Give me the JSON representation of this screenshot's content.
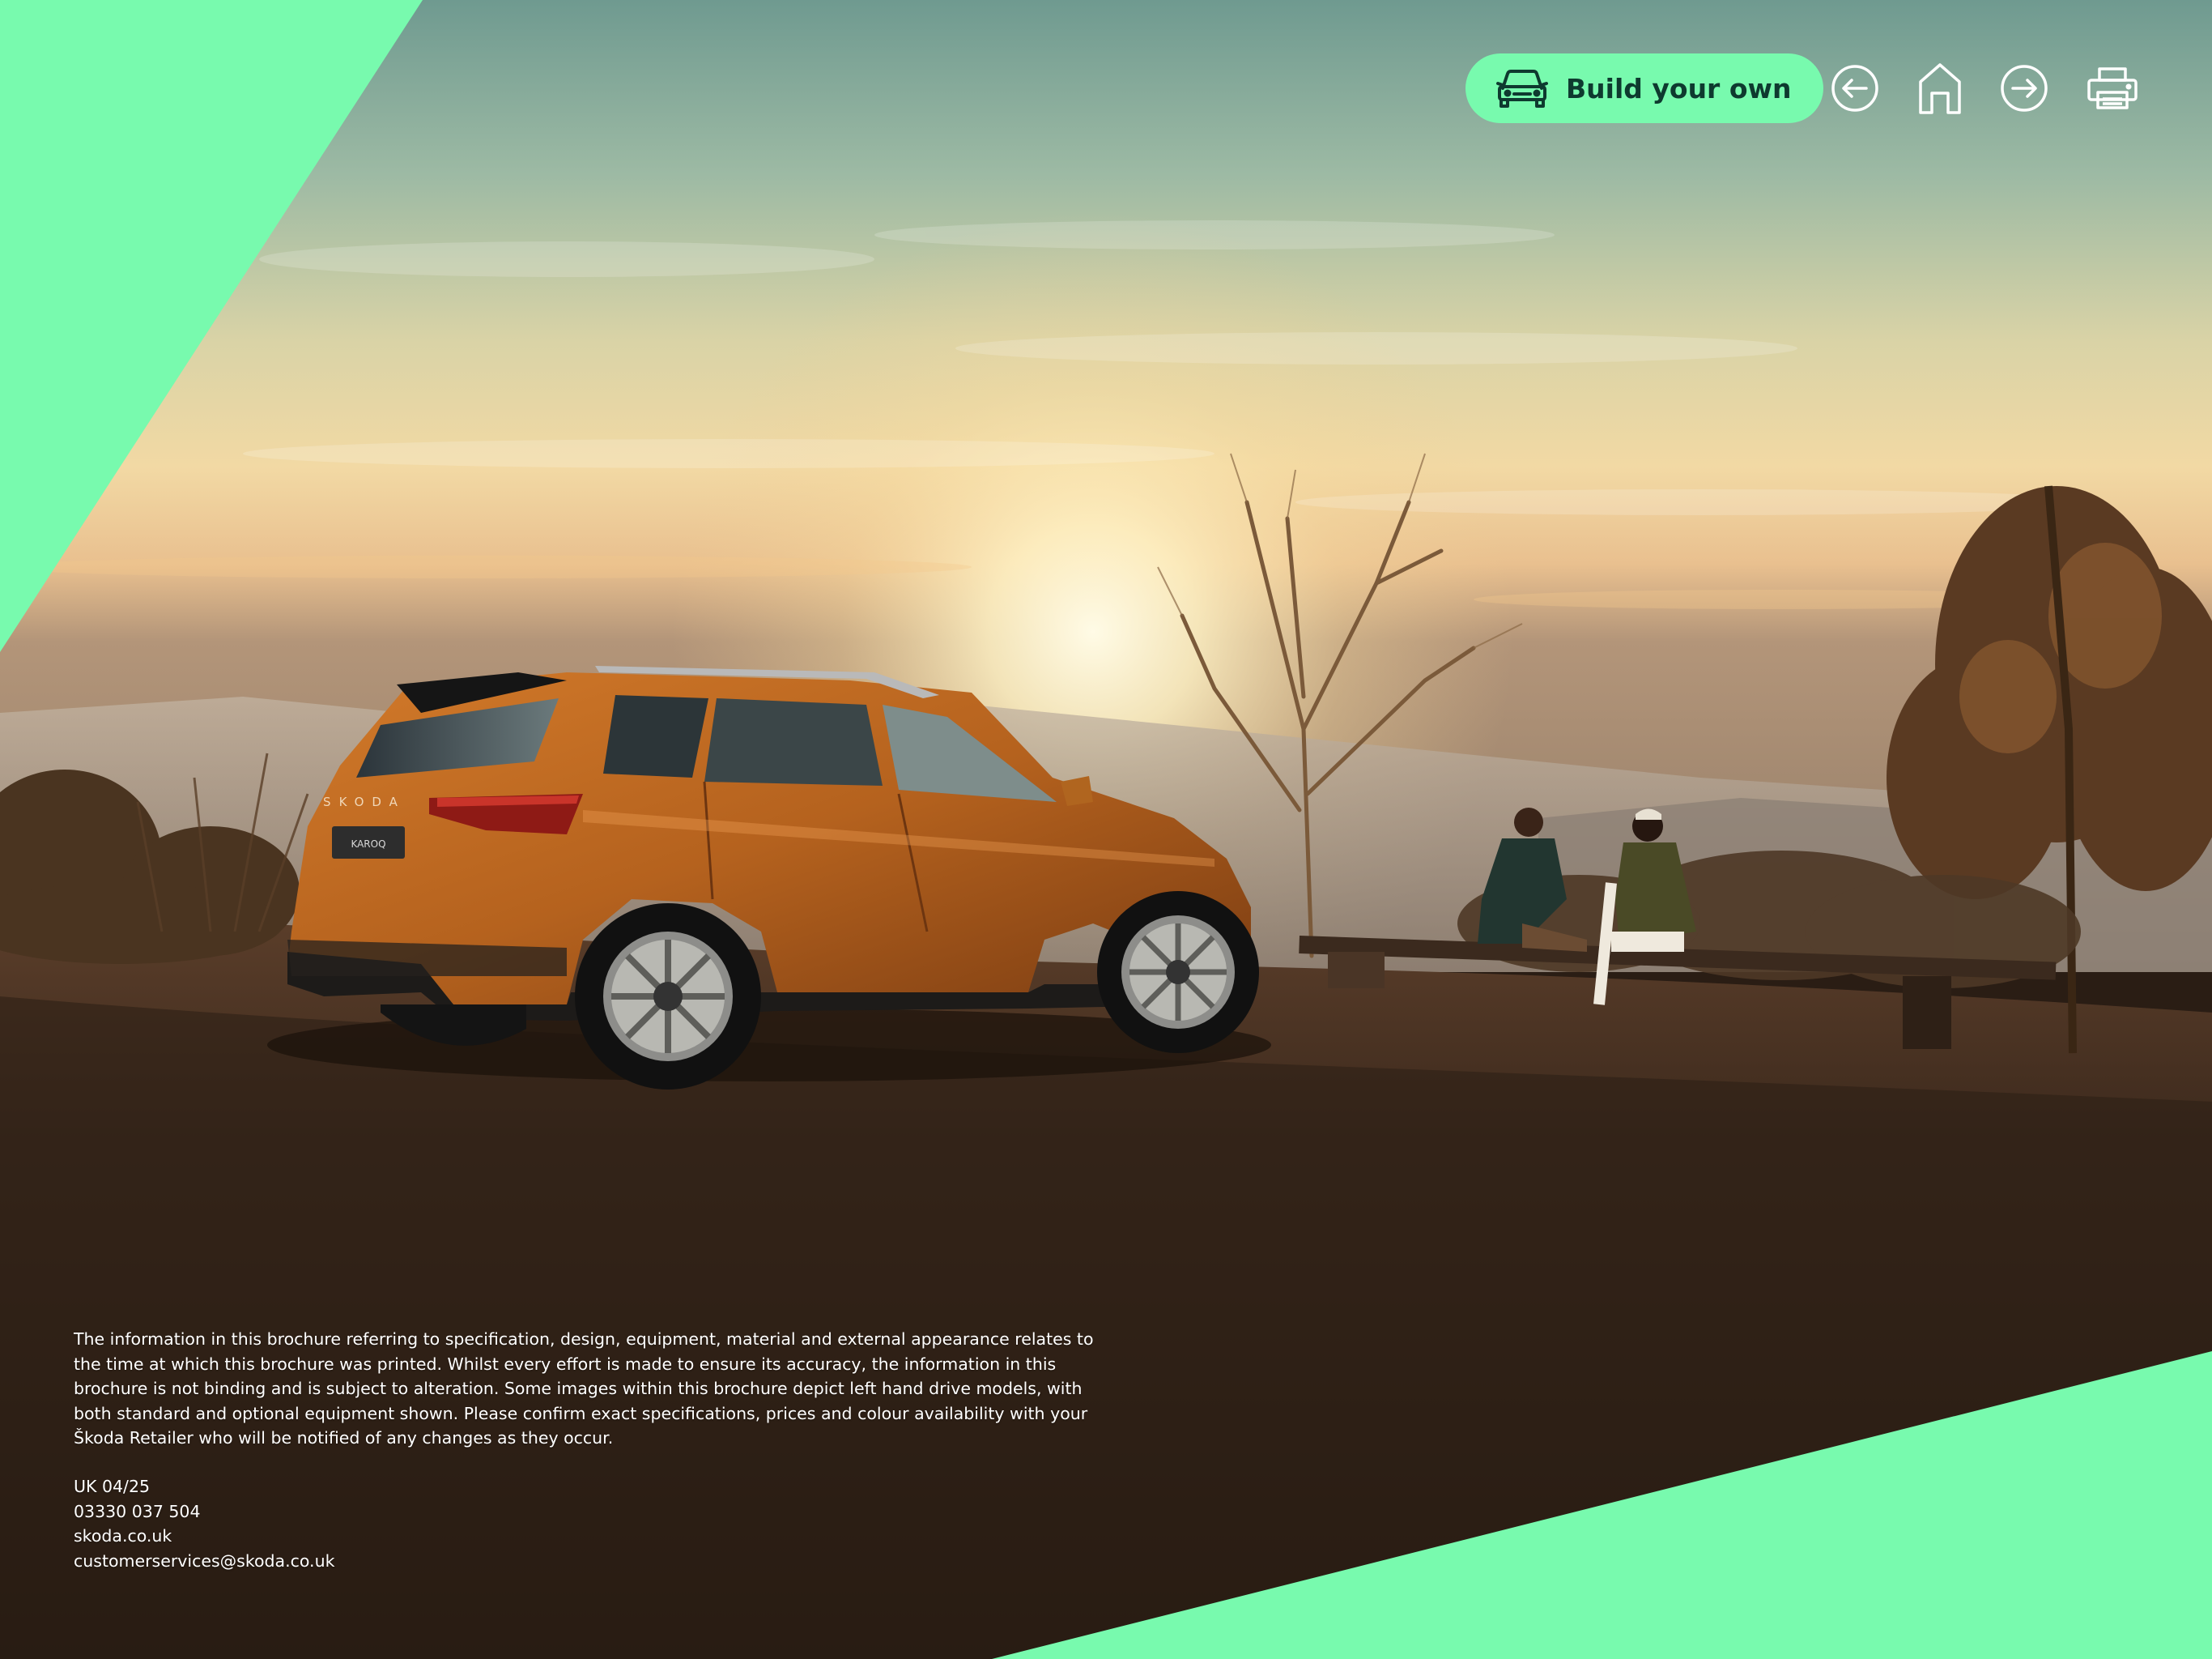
{
  "toolbar": {
    "build_label": "Build your own",
    "build_icon": "car-icon",
    "back_icon": "arrow-left-circle-icon",
    "home_icon": "home-icon",
    "forward_icon": "arrow-right-circle-icon",
    "print_icon": "printer-icon"
  },
  "disclaimer": {
    "text": "The information in this brochure referring to specification, design, equipment, material and external appearance relates to the time at which this brochure was printed. Whilst every effort is made to ensure its accuracy, the information in this brochure is not binding and is subject to alteration. Some images within this brochure depict left hand drive models, with both standard and optional equipment shown. Please confirm exact specifications, prices and colour availability with your Škoda Retailer who will be notified of any changes as they occur."
  },
  "contact": {
    "edition": "UK 04/25",
    "phone": "03330 037 504",
    "website": "skoda.co.uk",
    "email": "customerservices@skoda.co.uk"
  },
  "colors": {
    "accent_green": "#78faae",
    "dark_green": "#0e3a2f",
    "car_orange": "#b5621e"
  },
  "photo": {
    "car_badge": "KAROQ",
    "car_brand": "SKODA"
  }
}
